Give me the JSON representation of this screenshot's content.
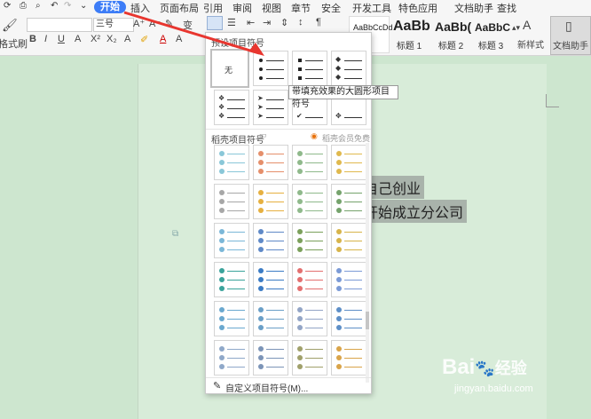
{
  "menubar": {
    "items": [
      "开始",
      "插入",
      "页面布局",
      "引用",
      "审阅",
      "视图",
      "章节",
      "安全",
      "开发工具",
      "特色应用",
      "文档助手"
    ],
    "search": "查找"
  },
  "ribbon": {
    "format_painter": "格式刷",
    "font_size": "三号",
    "style1": {
      "preview": "AaBbCcDd",
      "label": ""
    },
    "style2": {
      "preview": "AaBb",
      "label": "标题 1"
    },
    "style3": {
      "preview": "AaBb(",
      "label": "标题 2"
    },
    "style4": {
      "preview": "AaBbC",
      "label": "标题 3"
    },
    "new_style": "新样式",
    "doc_assistant": "文档助手",
    "bold": "B",
    "italic": "I",
    "underline": "U",
    "font_color": "A"
  },
  "dropdown": {
    "preset_title": "预设项目符号",
    "none_label": "无",
    "tooltip": "带填充效果的大圆形项目符号",
    "premium_title": "稻壳项目符号",
    "premium_badge": "稻壳会员免费",
    "custom": "自定义项目符号(M)..."
  },
  "document": {
    "line1": "自己创业",
    "line2": "开始成立分公司"
  },
  "watermark": {
    "brand": "Bai",
    "suffix": "经验",
    "url": "jingyan.baidu.com"
  },
  "colors": {
    "accent": "#3d7df7",
    "arrow": "#e8362f",
    "doc_bg": "#cde6cf"
  }
}
